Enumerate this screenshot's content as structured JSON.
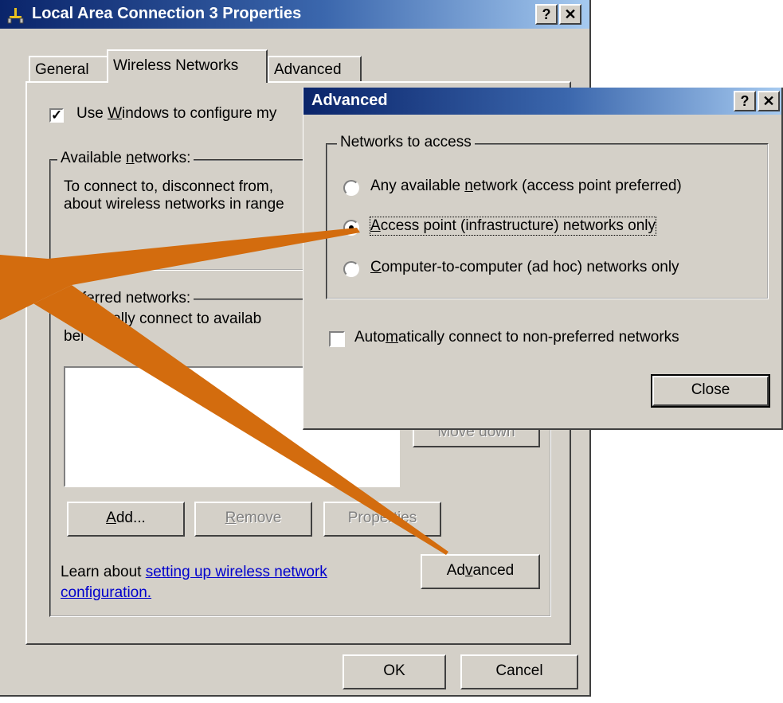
{
  "main_window": {
    "title": "Local Area Connection 3 Properties",
    "help_btn": "?",
    "close_btn": "✕",
    "tabs": [
      {
        "label": "General"
      },
      {
        "label": "Wireless Networks"
      },
      {
        "label": "Advanced"
      }
    ],
    "use_windows_pre": "Use ",
    "use_windows_key": "W",
    "use_windows_post": "indows to configure my",
    "use_windows_checked": "✓",
    "available_label_pre": "Available ",
    "available_label_key": "n",
    "available_label_post": "etworks:",
    "available_text_1": "To connect to, disconnect from,",
    "available_text_2": "about wireless networks in range",
    "preferred_label": "referred networks:",
    "preferred_text_1": "tomatically connect to availab",
    "preferred_text_2": "bel",
    "move_down_label": "Move down",
    "add_label_key": "A",
    "add_label_post": "dd...",
    "remove_label_key": "R",
    "remove_label_post": "emove",
    "properties_label": "Properties",
    "learn_text": "Learn about ",
    "learn_link_1": "setting up wireless network",
    "learn_link_2": "configuration.",
    "advanced_label_pre": "Ad",
    "advanced_label_key": "v",
    "advanced_label_post": "anced",
    "ok_label": "OK",
    "cancel_label": "Cancel"
  },
  "advanced_dialog": {
    "title": "Advanced",
    "help_btn": "?",
    "close_btn": "✕",
    "group_label": "Networks to access",
    "options": [
      {
        "pre": "Any available ",
        "key": "n",
        "post": "etwork (access point preferred)",
        "checked": false
      },
      {
        "pre": "",
        "key": "A",
        "post": "ccess point (infrastructure) networks only",
        "checked": true
      },
      {
        "pre": "",
        "key": "C",
        "post": "omputer-to-computer (ad hoc) networks only",
        "checked": false
      }
    ],
    "auto_connect_pre": "Auto",
    "auto_connect_key": "m",
    "auto_connect_post": "atically connect to non-preferred networks",
    "close_label": "Close"
  },
  "colors": {
    "title_start": "#0a246a",
    "title_end": "#a6caf0",
    "window_bg": "#d4d0c8",
    "arrow": "#d36c0e",
    "link": "#0000cc"
  }
}
